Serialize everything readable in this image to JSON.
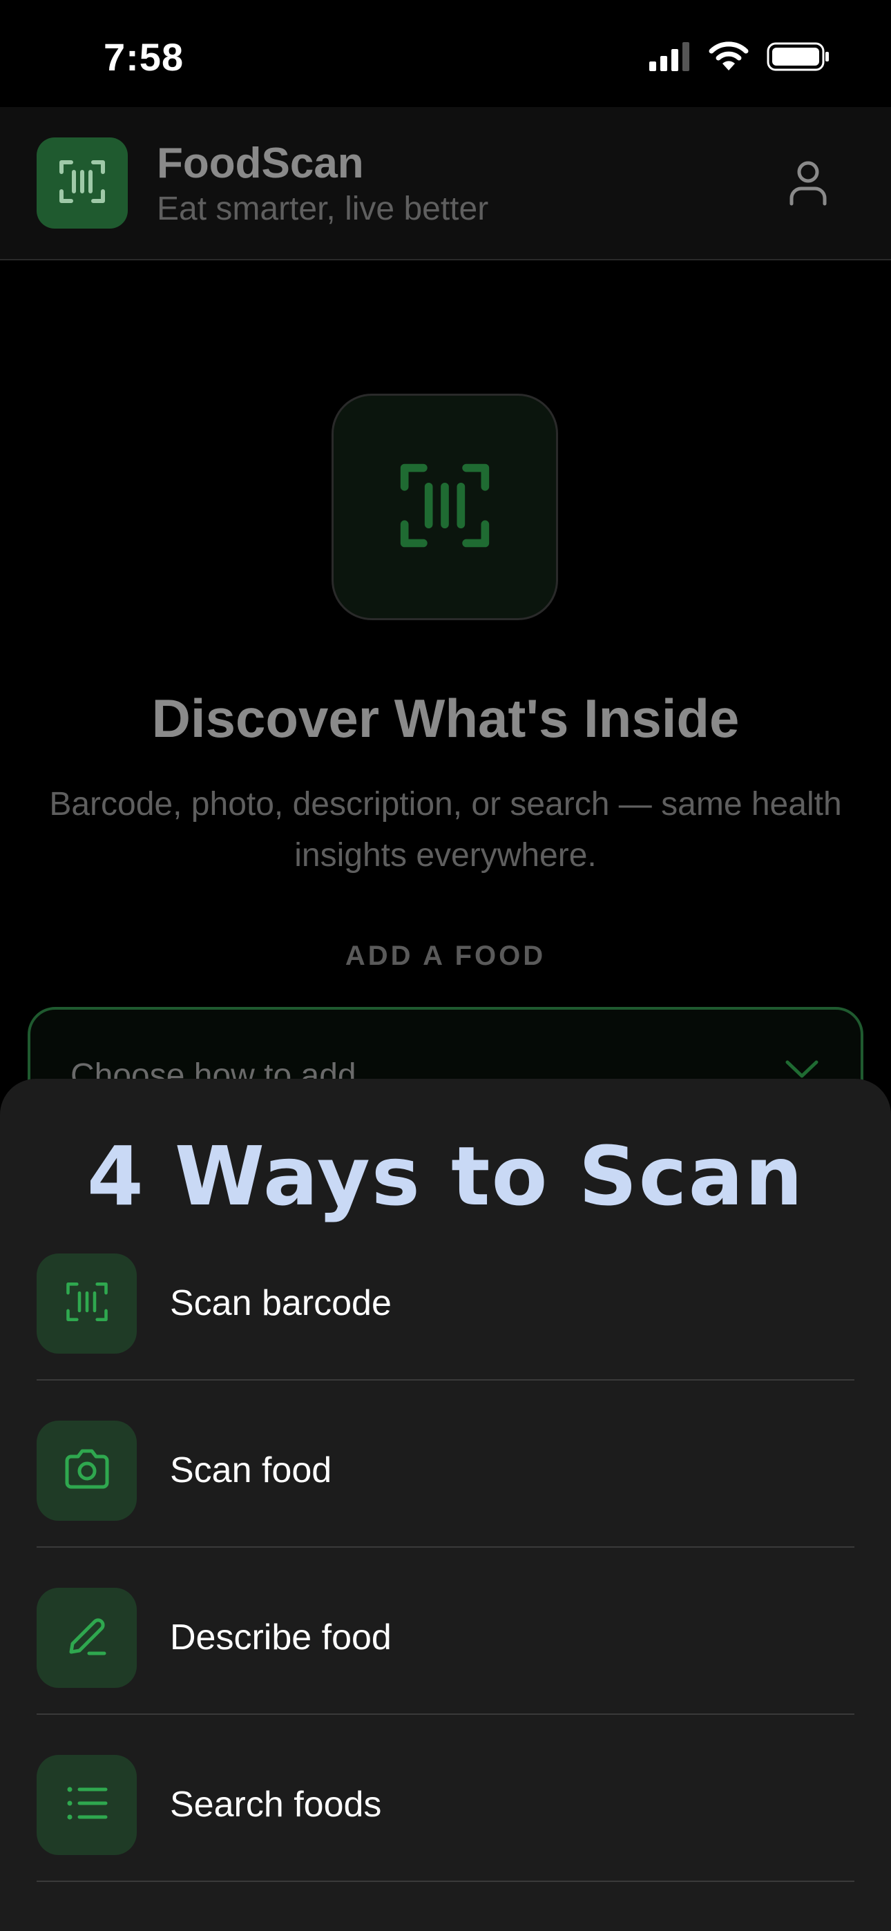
{
  "status_bar": {
    "time": "7:58"
  },
  "header": {
    "app_name": "FoodScan",
    "tagline": "Eat smarter, live better",
    "logo_icon": "barcode-scan-icon",
    "profile_icon": "user-icon"
  },
  "hero": {
    "title": "Discover What's Inside",
    "description": "Barcode, photo, description, or search — same health insights everywhere."
  },
  "add_food": {
    "section_label": "ADD A FOOD",
    "dropdown_placeholder": "Choose how to add"
  },
  "sheet": {
    "title": "4 Ways to Scan",
    "options": [
      {
        "label": "Scan barcode",
        "icon": "barcode-scan-icon"
      },
      {
        "label": "Scan food",
        "icon": "camera-icon"
      },
      {
        "label": "Describe food",
        "icon": "pencil-icon"
      },
      {
        "label": "Search foods",
        "icon": "list-icon"
      }
    ]
  },
  "colors": {
    "accent_green": "#2fa84f",
    "icon_tile": "#1f3b26",
    "sheet_background": "#1c1c1c",
    "sheet_title": "#c9d9f5"
  }
}
